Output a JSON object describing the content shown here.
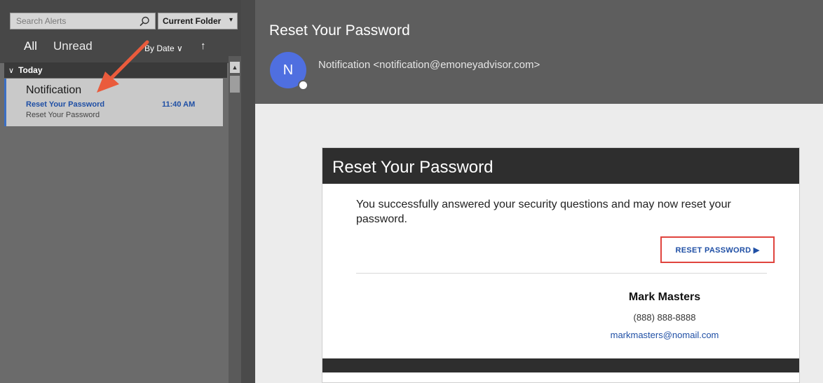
{
  "search": {
    "placeholder": "Search Alerts",
    "scope": "Current Folder"
  },
  "filters": {
    "all": "All",
    "unread": "Unread",
    "sort": "By Date ∨",
    "sort_direction_glyph": "↑"
  },
  "message_list": {
    "group": "Today",
    "items": [
      {
        "sender": "Notification",
        "subject": "Reset Your Password",
        "time": "11:40 AM",
        "preview": "Reset Your Password"
      }
    ]
  },
  "reading_pane": {
    "subject": "Reset Your Password",
    "avatar_initial": "N",
    "from": "Notification <notification@emoneyadvisor.com>"
  },
  "email": {
    "title": "Reset Your Password",
    "message": "You successfully answered your security questions and may now reset your password.",
    "button_label": "RESET PASSWORD ▶",
    "signature": {
      "name": "Mark Masters",
      "phone": "(888) 888-8888",
      "email": "markmasters@nomail.com"
    }
  },
  "colors": {
    "accent": "#1f4fa5",
    "avatar": "#4f6fe0",
    "highlight": "#e0443e"
  }
}
